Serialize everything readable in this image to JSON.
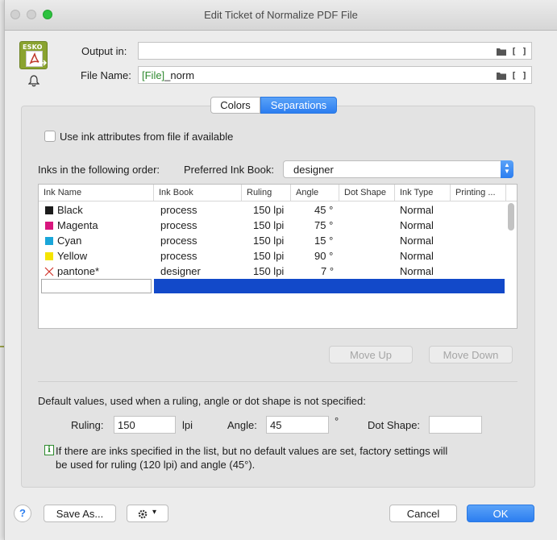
{
  "window": {
    "title": "Edit Ticket of Normalize PDF File"
  },
  "icons": {
    "app": "esko-pdf-icon",
    "app_tag": "ESKO",
    "notify": "bell-icon"
  },
  "output": {
    "label": "Output in:",
    "value": ""
  },
  "filename": {
    "label": "File Name:",
    "token": "[File]",
    "suffix": "_norm"
  },
  "field_buttons": {
    "bracket": "[ ]"
  },
  "tabs": [
    {
      "label": "Colors",
      "selected": false
    },
    {
      "label": "Separations",
      "selected": true
    }
  ],
  "separations": {
    "use_ink_attributes_label": "Use ink attributes from file if available",
    "use_ink_attributes_checked": false,
    "inks_order_label": "Inks in the following order:",
    "preferred_ink_book_label": "Preferred Ink Book:",
    "preferred_ink_book_value": "designer",
    "table": {
      "columns": [
        "Ink Name",
        "Ink Book",
        "Ruling",
        "Angle",
        "Dot Shape",
        "Ink Type",
        "Printing ..."
      ],
      "rows": [
        {
          "name": "Black",
          "color": "#1c1c1c",
          "book": "process",
          "ruling": "150 lpi",
          "angle": "45 °",
          "dot_shape": "",
          "ink_type": "Normal",
          "printing": ""
        },
        {
          "name": "Magenta",
          "color": "#d8177e",
          "book": "process",
          "ruling": "150 lpi",
          "angle": "75 °",
          "dot_shape": "",
          "ink_type": "Normal",
          "printing": ""
        },
        {
          "name": "Cyan",
          "color": "#1aa6d9",
          "book": "process",
          "ruling": "150 lpi",
          "angle": "15 °",
          "dot_shape": "",
          "ink_type": "Normal",
          "printing": ""
        },
        {
          "name": "Yellow",
          "color": "#f5e400",
          "book": "process",
          "ruling": "150 lpi",
          "angle": "90 °",
          "dot_shape": "",
          "ink_type": "Normal",
          "printing": ""
        },
        {
          "name": "pantone*",
          "color": "none",
          "book": "designer",
          "ruling": "150 lpi",
          "angle": "7 °",
          "dot_shape": "",
          "ink_type": "Normal",
          "printing": ""
        }
      ]
    },
    "move_up_label": "Move Up",
    "move_down_label": "Move Down",
    "defaults_label": "Default values, used when a ruling, angle or dot shape is not specified:",
    "ruling_label": "Ruling:",
    "ruling_value": "150",
    "ruling_unit": "lpi",
    "angle_label": "Angle:",
    "angle_value": "45",
    "angle_unit": "°",
    "dot_shape_label": "Dot Shape:",
    "dot_shape_value": "",
    "info_text_line1": "If there are inks specified in the list, but no default values are set, factory settings will",
    "info_text_line2": "be used for ruling (120 lpi) and angle (45°)."
  },
  "footer": {
    "help_label": "?",
    "save_as_label": "Save As...",
    "gear_label": "▾",
    "cancel_label": "Cancel",
    "ok_label": "OK"
  },
  "colors": {
    "accent": "#2c7ef0",
    "selection": "#1249c9",
    "token_green": "#2f8a2f"
  }
}
